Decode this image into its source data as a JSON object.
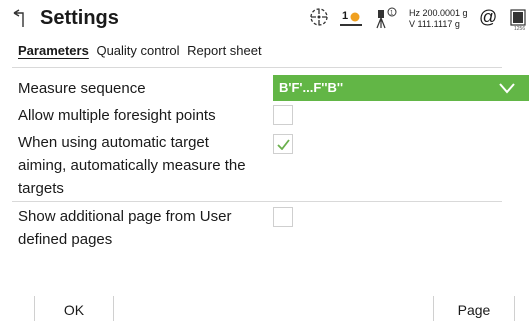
{
  "header": {
    "title": "Settings",
    "status": {
      "target_count": "1",
      "hz_text": "Hz 200.0001 g",
      "v_text": "V   111.1117 g",
      "at_symbol": "@",
      "battery_text": "1256"
    }
  },
  "tabs": [
    {
      "label": "Parameters",
      "active": true
    },
    {
      "label": "Quality control",
      "active": false
    },
    {
      "label": "Report sheet",
      "active": false
    }
  ],
  "settings": {
    "measure_sequence": {
      "label": "Measure sequence",
      "value": "B'F'...F''B''"
    },
    "allow_multiple_foresight": {
      "label": "Allow multiple foresight points",
      "checked": false
    },
    "auto_target_aiming": {
      "label_line1": "When using automatic target",
      "label_line2": "aiming, automatically measure the",
      "label_line3": "targets",
      "checked": true
    },
    "show_additional_page": {
      "label_line1": "Show additional page from User",
      "label_line2": "defined pages",
      "checked": false
    }
  },
  "footer": {
    "ok_label": "OK",
    "page_label": "Page"
  },
  "colors": {
    "accent_green": "#62b646",
    "check_green": "#6ab04c",
    "target_orange": "#f0a020"
  }
}
